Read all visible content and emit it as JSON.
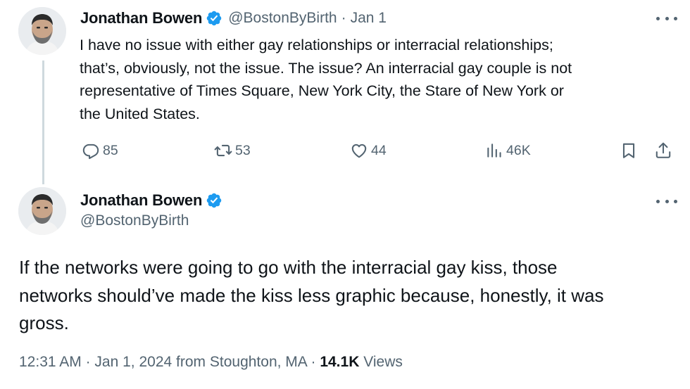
{
  "tweet1": {
    "author_name": "Jonathan Bowen",
    "handle": "@BostonByBirth",
    "separator": "·",
    "date": "Jan 1",
    "text_lines": [
      "I have no issue with either gay relationships or interracial relationships;",
      "that’s, obviously, not the issue. The issue? An interracial gay couple is not",
      "representative of Times Square, New York City, the Stare of New York or",
      "the United States."
    ],
    "stats": {
      "replies": "85",
      "reposts": "53",
      "likes": "44",
      "views": "46K"
    }
  },
  "tweet2": {
    "author_name": "Jonathan Bowen",
    "handle": "@BostonByBirth",
    "text_lines": [
      "If the networks were going to go with the interracial gay kiss, those",
      "networks should’ve made the kiss less graphic because, honestly, it was",
      "gross."
    ],
    "time": "12:31 AM",
    "separator": "·",
    "full_date": "Jan 1, 2024",
    "location": "from Stoughton, MA",
    "views_count": "14.1K",
    "views_label": "Views"
  },
  "icons": {
    "verified": "verified-badge-icon",
    "more": "more-dots-icon",
    "reply": "reply-icon",
    "repost": "repost-icon",
    "like": "like-icon",
    "views": "views-icon",
    "bookmark": "bookmark-icon",
    "share": "share-icon"
  },
  "colors": {
    "text_primary": "#0f1419",
    "text_secondary": "#536471",
    "verified_blue": "#1d9bf0",
    "thread_line": "#cfd9de"
  }
}
